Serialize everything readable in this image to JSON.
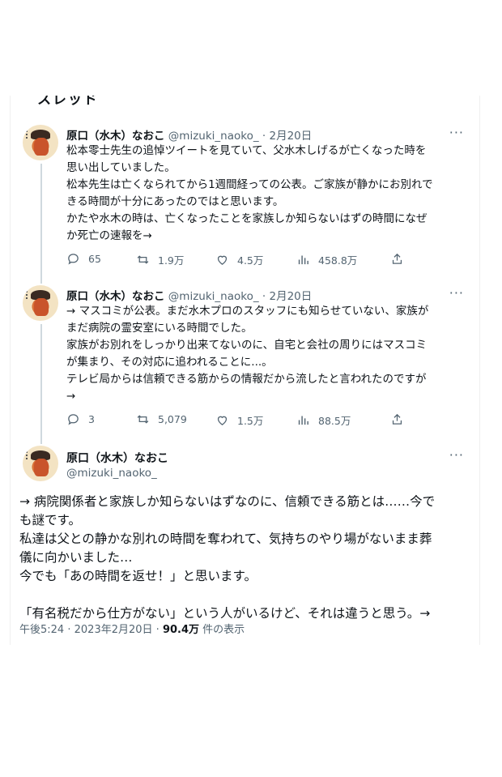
{
  "header": {
    "title_partial": "スレッド"
  },
  "tweets": [
    {
      "name": "原口（水木）なおこ",
      "handle": "@mizuki_naoko_",
      "dot": "·",
      "date": "2月20日",
      "more": "···",
      "text": "松本零士先生の追悼ツイートを見ていて、父水木しげるが亡くなった時を\n思い出していました。\n松本先生は亡くなられてから1週間経っての公表。ご家族が静かにお別れで\nきる時間が十分にあったのではと思います。\nかたや水木の時は、亡くなったことを家族しか知らないはずの時間になぜ\nか死亡の速報を→",
      "replies": "65",
      "retweets": "1.9万",
      "likes": "4.5万",
      "views": "458.8万"
    },
    {
      "name": "原口（水木）なおこ",
      "handle": "@mizuki_naoko_",
      "dot": "·",
      "date": "2月20日",
      "more": "···",
      "text": "→ マスコミが公表。まだ水木プロのスタッフにも知らせていない、家族が\nまだ病院の霊安室にいる時間でした。\n家族がお別れをしっかり出来てないのに、自宅と会社の周りにはマスコミ\nが集まり、その対応に追われることに...。\nテレビ局からは信頼できる筋からの情報だから流したと言われたのですが\n→",
      "replies": "3",
      "retweets": "5,079",
      "likes": "1.5万",
      "views": "88.5万"
    }
  ],
  "main_tweet": {
    "name": "原口（水木）なおこ",
    "handle": "@mizuki_naoko_",
    "more": "···",
    "text": "→ 病院関係者と家族しか知らないはずなのに、信頼できる筋とは……今で\nも謎です。\n私達は父との静かな別れの時間を奪われて、気持ちのやり場がないまま葬\n儀に向かいました…\n今でも「あの時間を返せ！」と思います。\n\n「有名税だから仕方がない」という人がいるけど、それは違うと思う。→",
    "time": "午後5:24",
    "date": "2023年2月20日",
    "views_count": "90.4万",
    "views_label": "件の表示",
    "sep": "·"
  },
  "icons": [
    "reply-icon",
    "retweet-icon",
    "like-icon",
    "views-icon",
    "share-icon",
    "more-icon"
  ],
  "colors": {
    "text": "#0f1419",
    "secondary": "#536471",
    "thread_line": "#cfd9de"
  }
}
